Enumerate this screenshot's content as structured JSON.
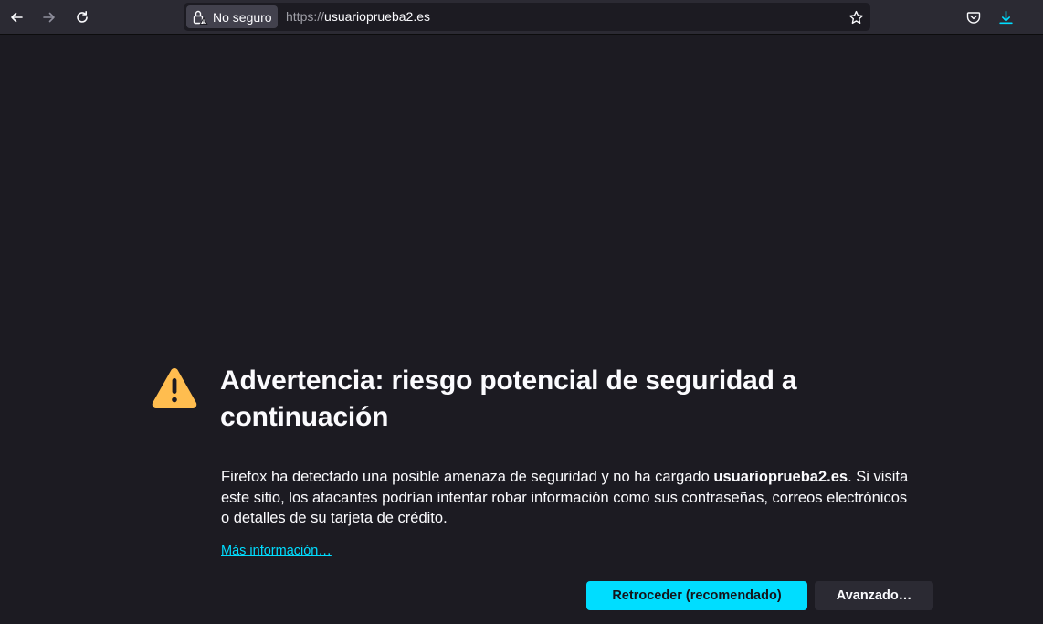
{
  "browser": {
    "identity_label": "No seguro",
    "url_scheme": "https://",
    "url_host": "usuarioprueba2.es",
    "icons": {
      "back": "arrow-left-icon",
      "forward": "arrow-right-icon",
      "reload": "reload-icon",
      "insecure_lock": "insecure-lock-icon",
      "bookmark": "star-icon",
      "pocket": "pocket-icon",
      "downloads": "download-icon"
    }
  },
  "page": {
    "title": "Advertencia: riesgo potencial de seguridad a continuación",
    "desc_before": "Firefox ha detectado una posible amenaza de seguridad y no ha cargado ",
    "desc_host": "usuarioprueba2.es",
    "desc_after": ". Si visita este sitio, los atacantes podrían intentar robar información como sus contraseñas, correos electrónicos o detalles de su tarjeta de crédito.",
    "learn_more": "Más información…",
    "go_back_button": "Retroceder (recomendado)",
    "advanced_button": "Avanzado…",
    "warning_icon": "warning-icon"
  },
  "colors": {
    "background": "#1c1b22",
    "toolbar": "#2b2a33",
    "accent": "#00ddff",
    "warning": "#ffbd4f"
  }
}
